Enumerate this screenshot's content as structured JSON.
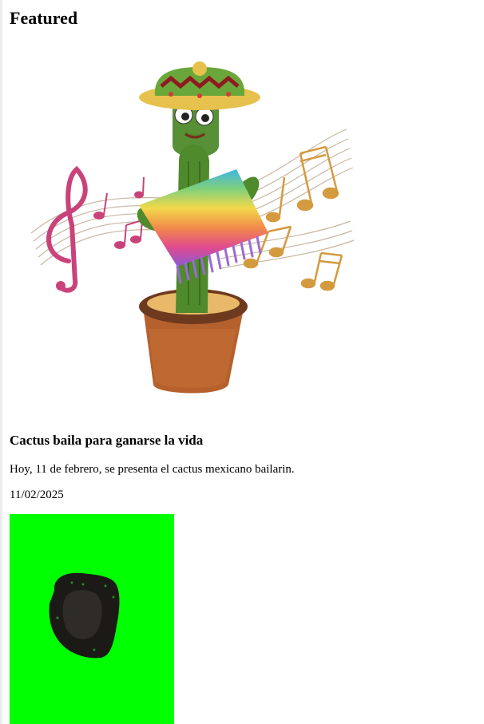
{
  "section": {
    "heading": "Featured"
  },
  "article": {
    "title": "Cactus baila para ganarse la vida",
    "summary": "Hoy, 11 de febrero, se presenta el cactus mexicano bailarin.",
    "date": "11/02/2025"
  },
  "images": {
    "hero_icon": "dancing-cactus-toy-image",
    "thumbnail_icon": "green-screen-thumbnail"
  },
  "colors": {
    "thumbnail_background": "#00ff00",
    "cactus_green": "#4f8a2c",
    "pot_brown": "#b5612d",
    "note_gold": "#d49a3f",
    "clef_pink": "#c9437a"
  }
}
